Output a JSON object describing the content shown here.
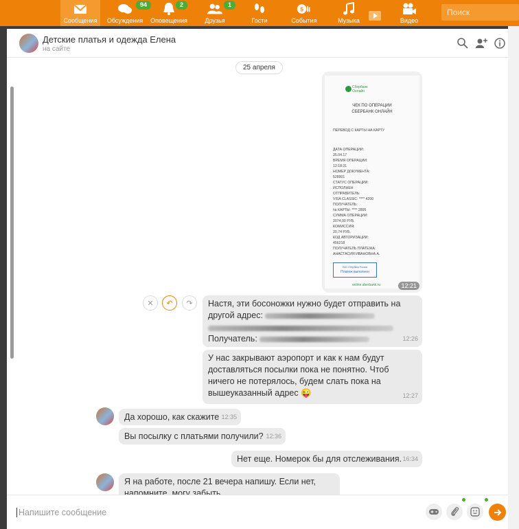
{
  "nav": {
    "items": [
      {
        "label": "Сообщения",
        "icon": "envelope-icon",
        "badge": ""
      },
      {
        "label": "Обсуждения",
        "icon": "chat-bubbles-icon",
        "badge": "94"
      },
      {
        "label": "Оповещения",
        "icon": "bell-icon",
        "badge": "2"
      },
      {
        "label": "Друзья",
        "icon": "people-icon",
        "badge": "1"
      },
      {
        "label": "Гости",
        "icon": "footprints-icon",
        "badge": ""
      },
      {
        "label": "События",
        "icon": "events-icon",
        "badge": ""
      },
      {
        "label": "Музыка",
        "icon": "music-note-icon",
        "badge": ""
      },
      {
        "label": "Видео",
        "icon": "video-camera-icon",
        "badge": ""
      }
    ],
    "search_placeholder": "Поиск"
  },
  "chat": {
    "title": "Детские платья и одежда Елена",
    "status": "на сайте",
    "date_separator": "25 апреля"
  },
  "receipt": {
    "bank_name": "Сбербанк",
    "bank_sub": "Онлайн",
    "heading_1": "ЧЕК ПО ОПЕРАЦИИ",
    "heading_2": "СБЕРБАНК ОНЛАЙН",
    "operation_type": "ПЕРЕВОД С КАРТЫ НА КАРТУ",
    "lines": "ДАТА ОПЕРАЦИИ:\n25.04.17\nВРЕМЯ ОПЕРАЦИИ:\n12:18:31\nНОМЕР ДОКУМЕНТА:\n528901\nСТАТУС ОПЕРАЦИИ:\nИСПОЛНЕН\nОТПРАВИТЕЛЬ:\nVISA CLASSIC: **** 4200\nПОЛУЧАТЕЛЬ:\n№ КАРТЫ: **** 2895\nСУММА ОПЕРАЦИИ:\n2074,00 РУБ.\nКОМИССИЯ:\n20,74 РУБ.\nКОД АВТОРИЗАЦИИ:\n456218\nПОЛУЧАТЕЛЬ ПЛАТЕЖА:\nАНАСТАСИЯ ИВАНОВНА А.",
    "stamp_top": "ПАО Сбербанк России",
    "stamp_main": "Платеж выполнен",
    "site": "online.sberbank.ru",
    "time": "12:21"
  },
  "messages": [
    {
      "text_1": "Настя, эти босоножки нужно будет отправить на",
      "text_2": "другой адрес:",
      "text_3": "Получатель:",
      "time": "12:26"
    },
    {
      "text": "У нас закрывают аэропорт и как к нам будут доставляться посылки пока не понятно. Чтоб ничего не потерялось, будем слать пока на вышеуказанный адрес",
      "emoji": "😜",
      "time": "12:27"
    },
    {
      "text": "Да хорошо, как скажите",
      "time": "12:35"
    },
    {
      "text": "Вы посылку с платьями получили?",
      "time": "12:36"
    },
    {
      "text": "Нет еще. Номерок бы для отслеживания.",
      "time": "16:34"
    },
    {
      "text": "Я на работе, после 21 вечера напишу. Если нет, напомните, могу забыть",
      "time": ""
    }
  ],
  "input": {
    "placeholder": "Напишите сообщение"
  }
}
